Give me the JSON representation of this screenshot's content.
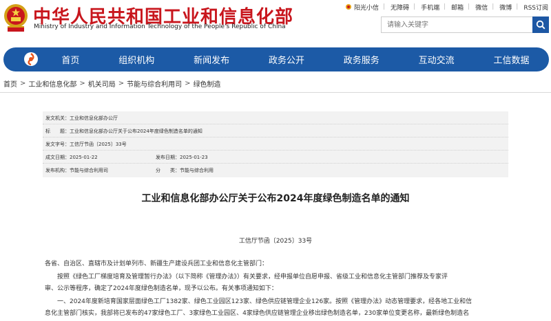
{
  "header": {
    "site_title": "中华人民共和国工业和信息化部",
    "site_subtitle": "Ministry of Industry and Information Technology of the People's Republic of China",
    "emblem_icon": "national-emblem-icon",
    "brand_color": "#c8161d"
  },
  "top_links": [
    {
      "label": "阳光小信",
      "icon": "sun-flower-icon"
    },
    {
      "label": "无障碍"
    },
    {
      "label": "手机端"
    },
    {
      "label": "邮箱"
    },
    {
      "label": "微信"
    },
    {
      "label": "微博"
    },
    {
      "label": "RSS订阅"
    }
  ],
  "search": {
    "placeholder": "请输入关键字",
    "button_icon": "search-icon",
    "button_color": "#1d57a4"
  },
  "nav": {
    "background": "#1c5aa6",
    "logo_icon": "ministry-logo-icon",
    "items": [
      "首页",
      "组织机构",
      "新闻发布",
      "政务公开",
      "政务服务",
      "互动交流",
      "工信数据"
    ]
  },
  "breadcrumb": [
    "首页",
    "工业和信息化部",
    "机关司局",
    "节能与综合利用司",
    "绿色制造"
  ],
  "meta": {
    "issuer_label": "发文机关：",
    "issuer_value": "工业和信息化部办公厅",
    "title_label": "标　　题：",
    "title_value": "工业和信息化部办公厅关于公布2024年度绿色制造名单的通知",
    "docno_label": "发文字号：",
    "docno_value": "工信厅节函〔2025〕33号",
    "created_label": "成文日期：",
    "created_value": "2025-01-22",
    "published_label": "发布日期：",
    "published_value": "2025-01-23",
    "org_label": "发布机构：",
    "org_value": "节能与综合利用司",
    "category_label": "分　　类：",
    "category_value": "节能与综合利用"
  },
  "article": {
    "title": "工业和信息化部办公厅关于公布2024年度绿色制造名单的通知",
    "doc_number": "工信厅节函〔2025〕33号",
    "salutation": "各省、自治区、直辖市及计划单列市、新疆生产建设兵团工业和信息化主管部门：",
    "p1_line1": "　　按照《绿色工厂梯度培育及管理暂行办法》（以下简称《管理办法》）有关要求，经申报单位自愿申报、省级工业和信息化主管部门推荐及专家评",
    "p1_line2": "审、公示等程序，确定了2024年度绿色制造名单，现予以公布。有关事项通知如下：",
    "p2_line1": "　　一、2024年度新培育国家层面绿色工厂1382家、绿色工业园区123家、绿色供应链管理企业126家。按照《管理办法》动态管理要求，经各地工业和信",
    "p2_line2": "息化主管部门核实，我部将已发布的47家绿色工厂、3家绿色工业园区、4家绿色供应链管理企业移出绿色制造名单，230家单位变更名称，最新绿色制造名"
  }
}
